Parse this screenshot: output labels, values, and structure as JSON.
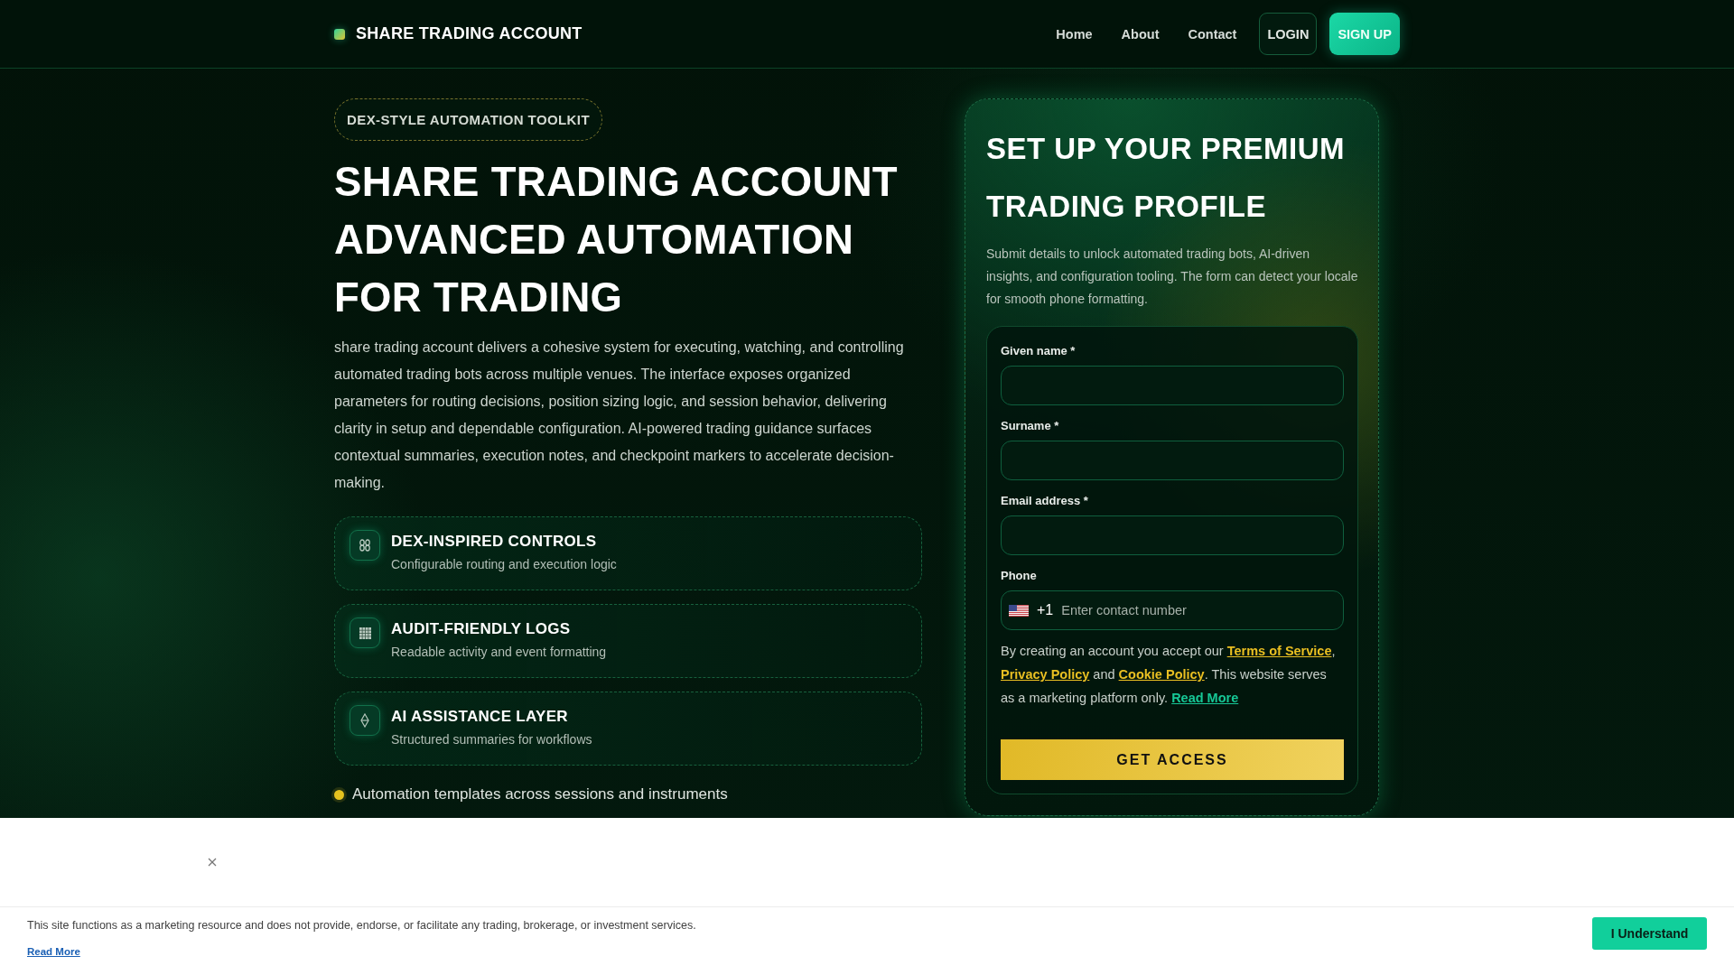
{
  "header": {
    "logo": "SHARE TRADING ACCOUNT",
    "nav": [
      {
        "label": "Home"
      },
      {
        "label": "About"
      },
      {
        "label": "Contact"
      }
    ],
    "actions": [
      {
        "label": "LOGIN",
        "kind": "outline"
      },
      {
        "label": "SIGN UP",
        "kind": "primary"
      }
    ]
  },
  "hero": {
    "badge": "DEX-STYLE AUTOMATION TOOLKIT",
    "title": "SHARE TRADING ACCOUNT ADVANCED AUTOMATION FOR TRADING",
    "description": "share trading account delivers a cohesive system for executing, watching, and controlling automated trading bots across multiple venues. The interface exposes organized parameters for routing decisions, position sizing logic, and session behavior, delivering clarity in setup and dependable configuration. AI-powered trading guidance surfaces contextual summaries, execution notes, and checkpoint markers to accelerate decision-making.",
    "features": [
      {
        "title": "DEX-INSPIRED CONTROLS",
        "text": "Configurable routing and execution logic"
      },
      {
        "title": "AUDIT-FRIENDLY LOGS",
        "text": "Readable activity and event formatting"
      },
      {
        "title": "AI ASSISTANCE LAYER",
        "text": "Structured summaries for workflows"
      }
    ],
    "bullets": [
      "Automation templates across sessions and instruments"
    ]
  },
  "signup": {
    "title": "SET UP YOUR PREMIUM TRADING PROFILE",
    "description": "Submit details to unlock automated trading bots, AI-driven insights, and configuration tooling. The form can detect your locale for smooth phone formatting.",
    "fields": [
      {
        "label": "Given name *",
        "kind": "text"
      },
      {
        "label": "Surname *",
        "kind": "text"
      },
      {
        "label": "Email address *",
        "kind": "text"
      },
      {
        "label": "Phone",
        "kind": "phone",
        "country_code": "+1",
        "placeholder": "Enter contact number"
      }
    ],
    "consent": [
      {
        "kind": "text",
        "text": "By creating an account you accept our "
      },
      {
        "kind": "policy",
        "text": "Terms of Service"
      },
      {
        "kind": "text",
        "text": ", "
      },
      {
        "kind": "policy",
        "text": "Privacy Policy"
      },
      {
        "kind": "text",
        "text": " and "
      },
      {
        "kind": "policy",
        "text": "Cookie Policy"
      },
      {
        "kind": "text",
        "text": ". This website serves as a marketing platform only. "
      },
      {
        "kind": "more",
        "text": "Read More"
      }
    ],
    "submit": "GET ACCESS"
  },
  "notice": {
    "text": "This site functions as a marketing resource and does not provide, endorse, or facilitate any trading, brokerage, or investment services.",
    "link": "Read More",
    "button": "I Understand"
  }
}
